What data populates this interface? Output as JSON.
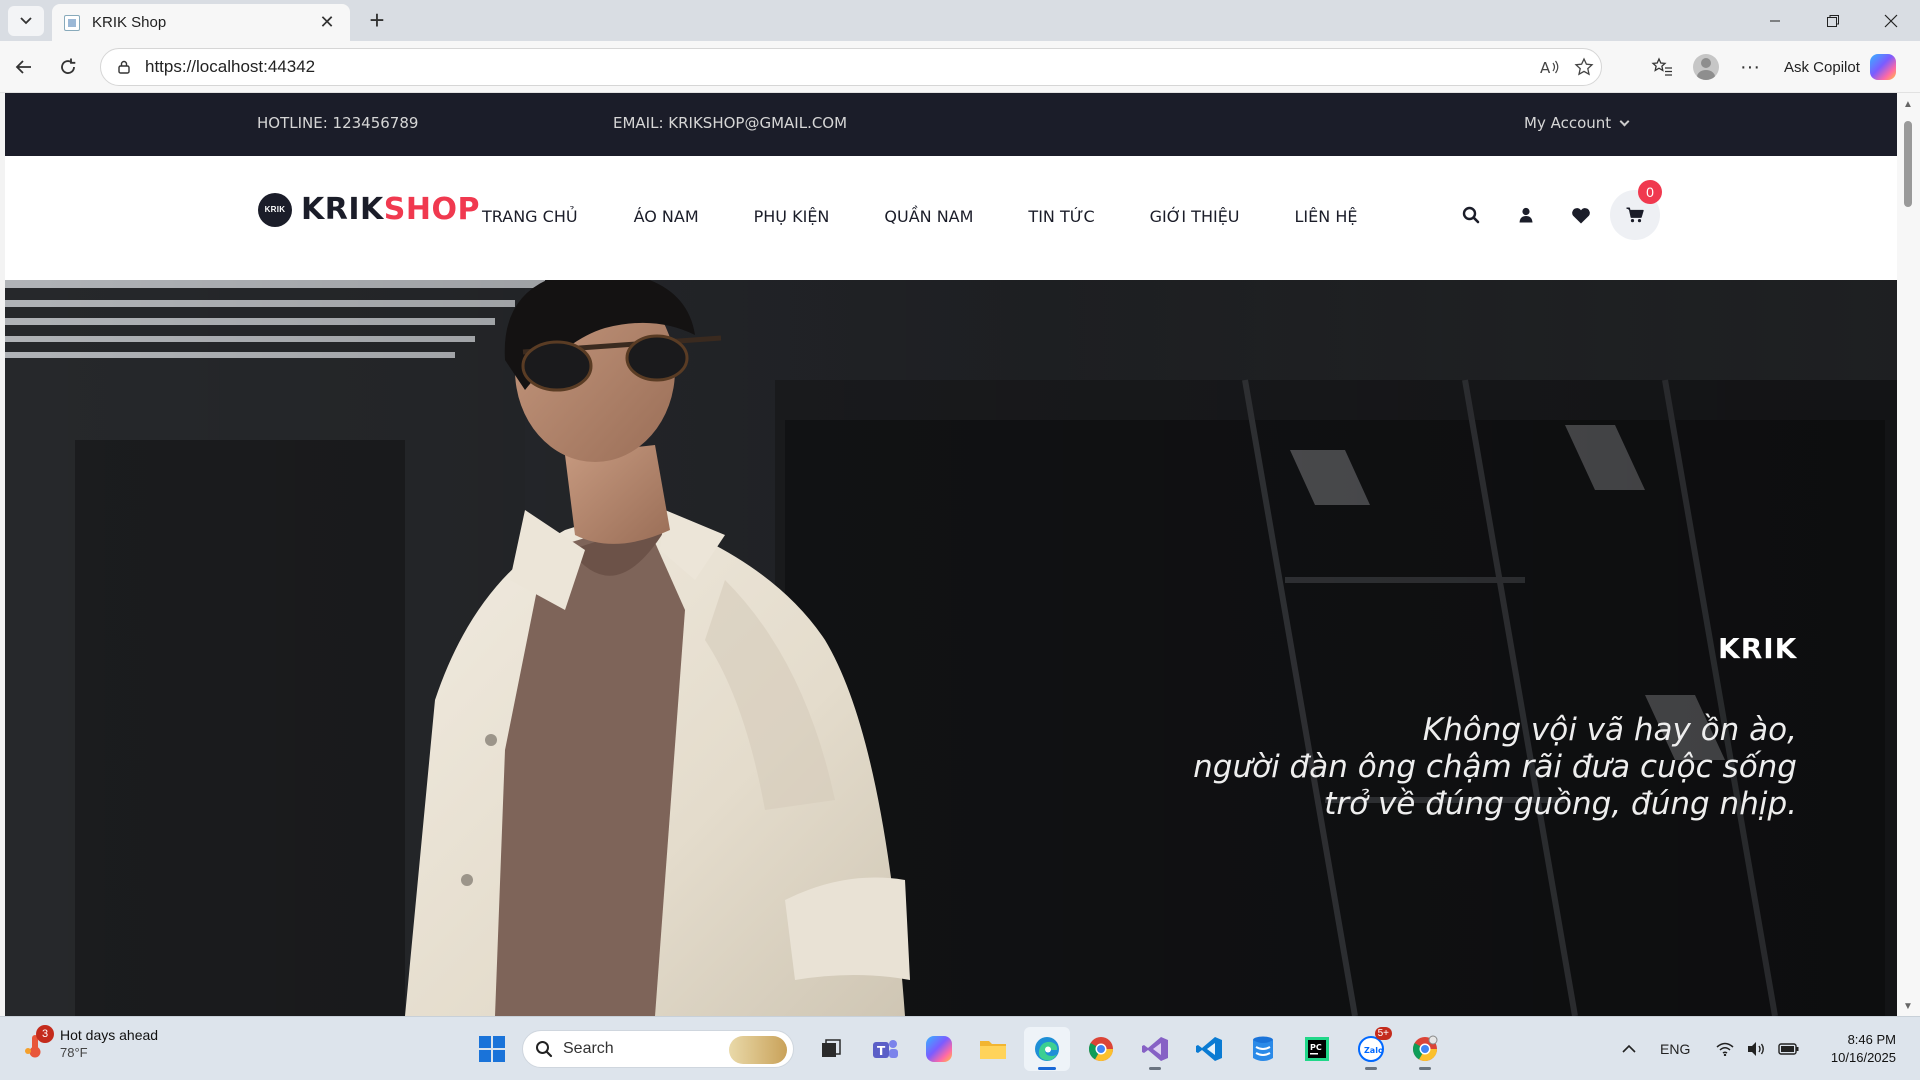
{
  "browser": {
    "tab_title": "KRIK Shop",
    "url": "https://localhost:44342",
    "copilot_label": "Ask Copilot"
  },
  "site": {
    "topbar": {
      "hotline": "HOTLINE: 123456789",
      "email": "EMAIL: KRIKSHOP@GMAIL.COM",
      "account": "My Account"
    },
    "logo": {
      "circle": "KRIK",
      "part1": "KRIK",
      "part2": "SHOP"
    },
    "menu": [
      {
        "label": "TRANG CHỦ"
      },
      {
        "label": "ÁO NAM"
      },
      {
        "label": "PHỤ KIỆN"
      },
      {
        "label": "QUẦN NAM"
      },
      {
        "label": "TIN TỨC"
      },
      {
        "label": "GIỚI THIỆU"
      },
      {
        "label": "LIÊN HỆ"
      }
    ],
    "cart_count": "0",
    "colors": {
      "dark": "#1b1d29",
      "accent": "#f0394f"
    },
    "icons": [
      "search-icon",
      "user-icon",
      "heart-icon",
      "cart-icon"
    ]
  },
  "hero": {
    "brand": "KRIK",
    "quote_lines": [
      "Không vội vã hay ồn ào,",
      "người đàn ông chậm rãi đưa cuộc sống",
      "trở về đúng guồng, đúng nhịp."
    ]
  },
  "taskbar": {
    "weather_badge": "3",
    "weather_title": "Hot days ahead",
    "weather_temp": "78°F",
    "search_label": "Search",
    "zalo_badge": "5+",
    "language": "ENG",
    "time": "8:46 PM",
    "date": "10/16/2025"
  }
}
